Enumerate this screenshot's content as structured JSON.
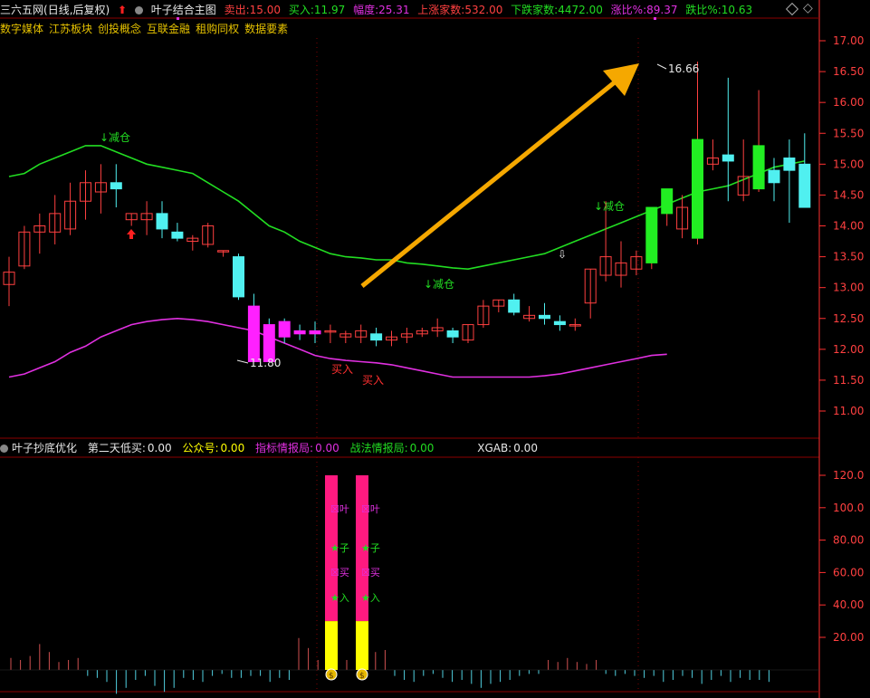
{
  "header": {
    "stock_name": "三六五网",
    "period": "(日线,后复权)",
    "indicator": "叶子结合主图",
    "sell_label": "卖出:",
    "sell_value": "15.00",
    "buy_label": "买入:",
    "buy_value": "11.97",
    "amplitude_label": "幅度:",
    "amplitude_value": "25.31",
    "up_count_label": "上涨家数:",
    "up_count_value": "532.00",
    "down_count_label": "下跌家数:",
    "down_count_value": "4472.00",
    "rise_ratio_label": "涨比%:",
    "rise_ratio_value": "89.37",
    "fall_ratio_label": "跌比%:",
    "fall_ratio_value": "10.63"
  },
  "concepts": [
    "数字媒体",
    "江苏板块",
    "创投概念",
    "互联金融",
    "租购同权",
    "数据要素"
  ],
  "lower_header": {
    "indicator": "叶子抄底优化",
    "second_day_label": "第二天低买:",
    "second_day_value": "0.00",
    "gzh_label": "公众号:",
    "gzh_value": "0.00",
    "index_label": "指标情报局:",
    "index_value": "0.00",
    "tactic_label": "战法情报局:",
    "tactic_value": "0.00",
    "xgab_label": "XGAB:",
    "xgab_value": "0.00"
  },
  "annotations": {
    "reduce_1": "↓减仓",
    "reduce_2": "↓减仓",
    "reduce_3": "↓减仓",
    "buy_1": "买入",
    "buy_2": "买入",
    "low_price": "11.80",
    "high_price": "16.66",
    "col_text_1": [
      "叶",
      "子",
      "买",
      "入"
    ],
    "col_text_2": [
      "叶",
      "子",
      "买",
      "入"
    ]
  },
  "colors": {
    "up": "#ff4040",
    "down": "#50f0f0",
    "mid_line": "#22dd22",
    "lower_line": "#e030e0",
    "arrow": "#f5a800",
    "bar_pink": "#ff1a80",
    "bar_yellow": "#ffff00"
  },
  "chart_data": [
    {
      "type": "candlestick",
      "y_ticks": [
        "17.00",
        "16.50",
        "16.00",
        "15.50",
        "15.00",
        "14.50",
        "14.00",
        "13.50",
        "13.00",
        "12.50",
        "12.00",
        "11.50",
        "11.00"
      ],
      "ylim": [
        10.7,
        17.5
      ],
      "candles": [
        [
          13.05,
          13.5,
          13.25,
          12.7
        ],
        [
          13.35,
          14.0,
          13.9,
          13.3
        ],
        [
          13.9,
          14.2,
          14.0,
          13.55
        ],
        [
          13.9,
          14.5,
          14.2,
          13.7
        ],
        [
          13.95,
          14.7,
          14.4,
          13.85
        ],
        [
          14.4,
          14.9,
          14.7,
          14.1
        ],
        [
          14.55,
          15.0,
          14.7,
          14.2
        ],
        [
          14.7,
          15.0,
          14.6,
          14.3
        ],
        [
          14.1,
          14.2,
          14.2,
          14.0
        ],
        [
          14.1,
          14.4,
          14.2,
          13.85
        ],
        [
          14.2,
          14.4,
          13.95,
          13.8
        ],
        [
          13.9,
          14.05,
          13.8,
          13.75
        ],
        [
          13.75,
          13.85,
          13.8,
          13.6
        ],
        [
          13.7,
          14.05,
          14.0,
          13.65
        ],
        [
          13.6,
          13.6,
          13.6,
          13.5
        ],
        [
          13.5,
          13.55,
          12.85,
          12.8
        ],
        [
          12.7,
          12.9,
          11.8,
          11.8
        ],
        [
          12.4,
          12.5,
          11.8,
          11.8
        ],
        [
          12.45,
          12.5,
          12.2,
          12.1
        ],
        [
          12.3,
          12.4,
          12.25,
          12.15
        ],
        [
          12.3,
          12.45,
          12.25,
          12.1
        ],
        [
          12.3,
          12.4,
          12.3,
          12.1
        ],
        [
          12.2,
          12.3,
          12.25,
          12.1
        ],
        [
          12.2,
          12.4,
          12.3,
          12.1
        ],
        [
          12.25,
          12.35,
          12.15,
          12.05
        ],
        [
          12.15,
          12.3,
          12.2,
          12.05
        ],
        [
          12.2,
          12.35,
          12.25,
          12.1
        ],
        [
          12.25,
          12.35,
          12.3,
          12.2
        ],
        [
          12.3,
          12.5,
          12.35,
          12.2
        ],
        [
          12.3,
          12.35,
          12.2,
          12.1
        ],
        [
          12.15,
          12.4,
          12.4,
          12.1
        ],
        [
          12.4,
          12.8,
          12.7,
          12.35
        ],
        [
          12.7,
          12.8,
          12.8,
          12.6
        ],
        [
          12.8,
          12.9,
          12.6,
          12.55
        ],
        [
          12.5,
          12.7,
          12.55,
          12.45
        ],
        [
          12.55,
          12.75,
          12.5,
          12.4
        ],
        [
          12.45,
          12.55,
          12.4,
          12.3
        ],
        [
          12.4,
          12.5,
          12.4,
          12.3
        ],
        [
          12.75,
          13.3,
          13.3,
          12.5
        ],
        [
          13.2,
          14.4,
          13.5,
          13.1
        ],
        [
          13.2,
          13.75,
          13.4,
          13.0
        ],
        [
          13.3,
          13.6,
          13.5,
          13.2
        ],
        [
          13.4,
          14.3,
          14.3,
          13.3
        ],
        [
          14.2,
          14.5,
          14.6,
          14.0
        ],
        [
          13.95,
          14.5,
          14.3,
          13.8
        ],
        [
          13.8,
          16.66,
          15.4,
          13.7
        ],
        [
          15.0,
          15.4,
          15.1,
          14.9
        ],
        [
          15.15,
          16.4,
          15.05,
          14.4
        ],
        [
          14.5,
          15.4,
          14.8,
          14.4
        ],
        [
          14.6,
          16.2,
          15.3,
          14.55
        ],
        [
          14.9,
          15.1,
          14.7,
          14.4
        ],
        [
          15.1,
          15.4,
          14.9,
          14.05
        ],
        [
          15.0,
          15.5,
          14.3,
          14.3
        ]
      ],
      "mid_band": [
        14.8,
        14.85,
        15.0,
        15.1,
        15.2,
        15.3,
        15.3,
        15.2,
        15.1,
        15.0,
        14.95,
        14.9,
        14.85,
        14.7,
        14.55,
        14.4,
        14.2,
        14.0,
        13.9,
        13.75,
        13.65,
        13.55,
        13.5,
        13.48,
        13.45,
        13.45,
        13.4,
        13.38,
        13.35,
        13.32,
        13.3,
        13.35,
        13.4,
        13.45,
        13.5,
        13.55,
        13.65,
        13.75,
        13.85,
        13.95,
        14.05,
        14.15,
        14.25,
        14.35,
        14.45,
        14.55,
        14.6,
        14.65,
        14.75,
        14.85,
        14.95,
        15.0,
        15.05
      ],
      "lower_band": [
        11.55,
        11.6,
        11.7,
        11.8,
        11.95,
        12.05,
        12.2,
        12.3,
        12.4,
        12.45,
        12.48,
        12.5,
        12.48,
        12.45,
        12.4,
        12.35,
        12.3,
        12.2,
        12.1,
        12.0,
        11.9,
        11.85,
        11.82,
        11.8,
        11.78,
        11.75,
        11.7,
        11.65,
        11.6,
        11.55,
        11.55,
        11.55,
        11.55,
        11.55,
        11.55,
        11.57,
        11.6,
        11.65,
        11.7,
        11.75,
        11.8,
        11.85,
        11.9,
        11.92
      ]
    },
    {
      "type": "bar",
      "y_ticks": [
        "120.0",
        "100.0",
        "80.00",
        "60.00",
        "40.00",
        "20.00"
      ],
      "ylim": [
        0,
        130
      ],
      "volume": [
        0.6,
        0.5,
        0.7,
        1.3,
        0.9,
        0.4,
        0.5,
        0.6,
        -0.3,
        -0.4,
        -0.6,
        -1.2,
        -0.9,
        -0.5,
        -0.3,
        -0.8,
        -1.1,
        -0.9,
        -0.4,
        -0.5,
        -0.6,
        -0.3,
        -0.2,
        -0.4,
        -0.4,
        -0.3,
        -0.3,
        -0.6,
        -0.4,
        -0.5,
        1.6,
        1.1,
        0.5,
        1.0,
        0.7,
        0.5,
        0.6,
        0.7,
        0.9,
        1.0,
        -0.3,
        -0.5,
        -0.6,
        -0.3,
        -0.2,
        -0.4,
        -0.6,
        -0.5,
        -0.7,
        -0.9,
        -0.7,
        -0.6,
        -0.5,
        -0.3,
        -0.2,
        -0.2,
        0.5,
        0.4,
        0.6,
        0.4,
        0.3,
        0.5,
        -0.2,
        -0.3,
        -0.2,
        -0.3,
        -0.4,
        -0.3,
        -0.6,
        -0.5,
        -0.3,
        -0.4,
        -0.7,
        -0.5,
        -0.3,
        -0.6,
        -0.4,
        -0.5,
        -0.5,
        -0.6
      ],
      "signal_bars": [
        {
          "pink": 120,
          "yellow": 30
        },
        {
          "pink": 120,
          "yellow": 30
        }
      ]
    }
  ]
}
